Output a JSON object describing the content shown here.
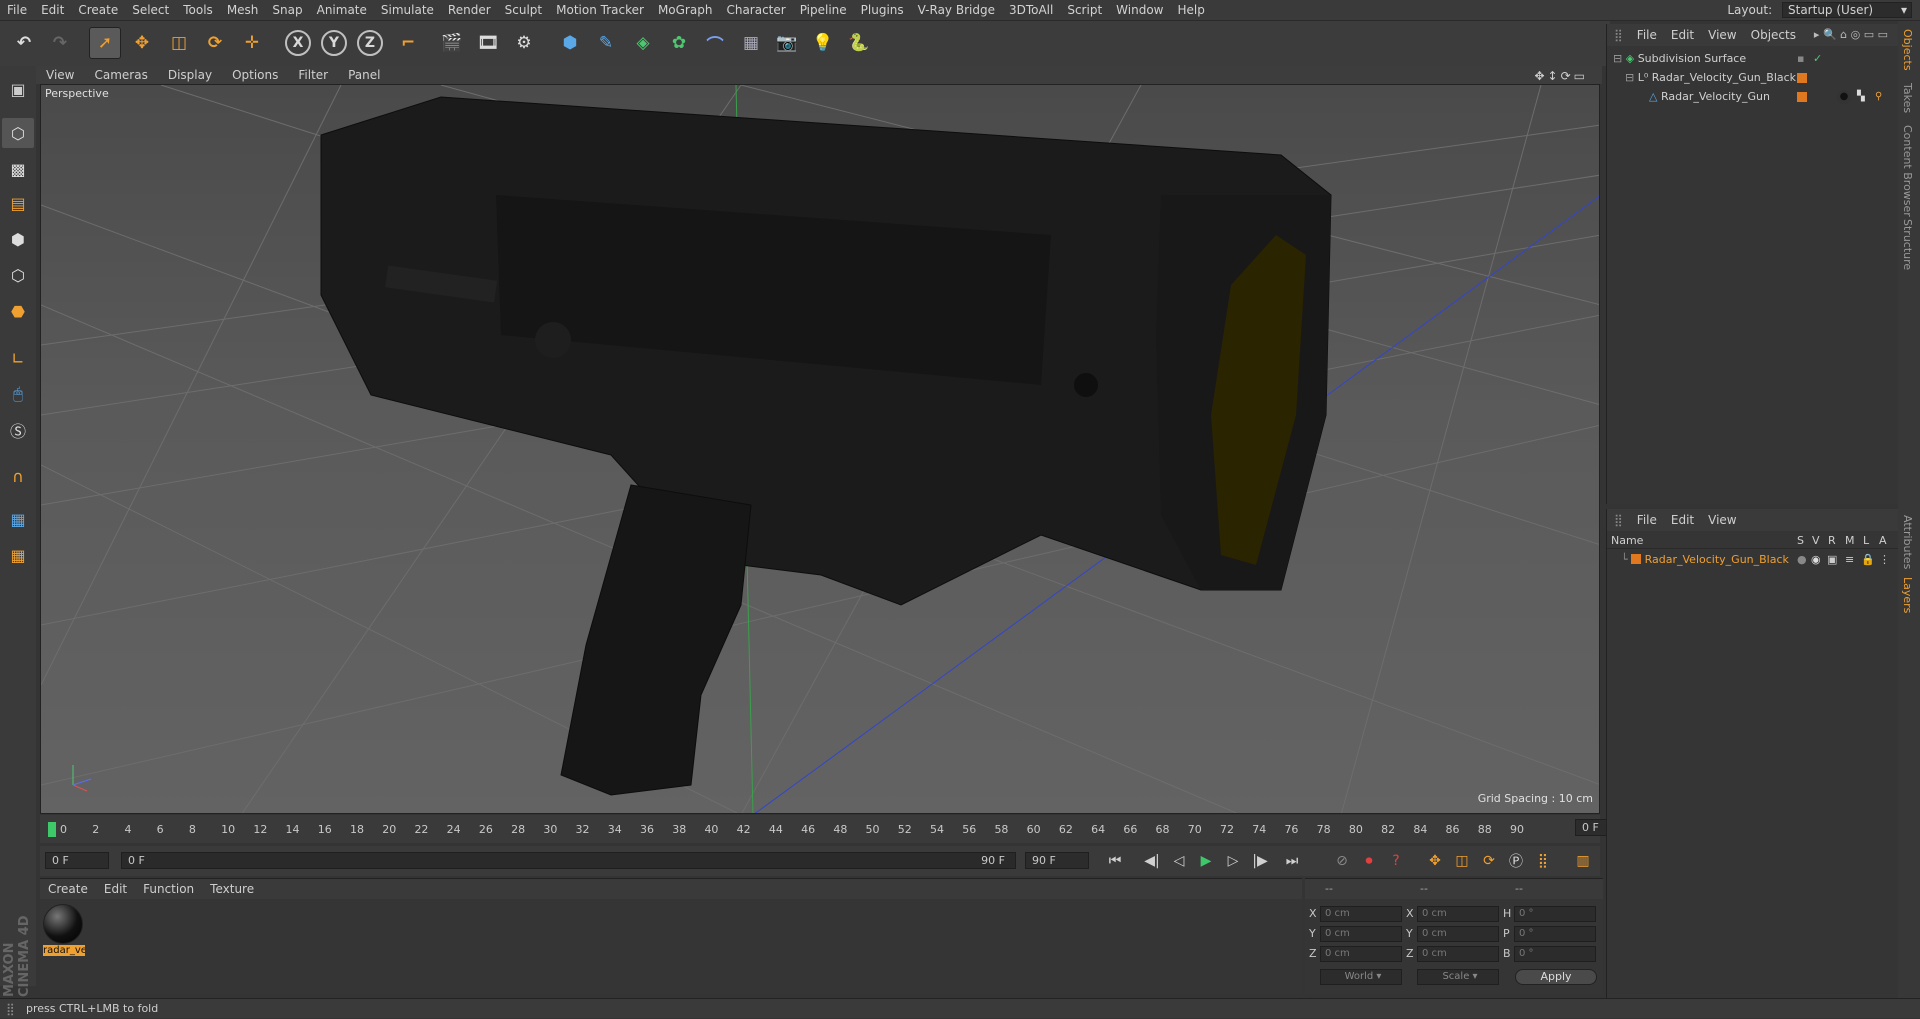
{
  "menubar": {
    "items": [
      "File",
      "Edit",
      "Create",
      "Select",
      "Tools",
      "Mesh",
      "Snap",
      "Animate",
      "Simulate",
      "Render",
      "Sculpt",
      "Motion Tracker",
      "MoGraph",
      "Character",
      "Pipeline",
      "Plugins",
      "V-Ray Bridge",
      "3DToAll",
      "Script",
      "Window",
      "Help"
    ],
    "layout_label": "Layout:",
    "layout_value": "Startup (User)"
  },
  "toolbar": {
    "axis_x": "X",
    "axis_y": "Y",
    "axis_z": "Z"
  },
  "viewport": {
    "menu": [
      "View",
      "Cameras",
      "Display",
      "Options",
      "Filter",
      "Panel"
    ],
    "camera_label": "Perspective",
    "grid_spacing": "Grid Spacing : 10 cm"
  },
  "timeline": {
    "ticks": [
      "0",
      "2",
      "4",
      "6",
      "8",
      "10",
      "12",
      "14",
      "16",
      "18",
      "20",
      "22",
      "24",
      "26",
      "28",
      "30",
      "32",
      "34",
      "36",
      "38",
      "40",
      "42",
      "44",
      "46",
      "48",
      "50",
      "52",
      "54",
      "56",
      "58",
      "60",
      "62",
      "64",
      "66",
      "68",
      "70",
      "72",
      "74",
      "76",
      "78",
      "80",
      "82",
      "84",
      "86",
      "88",
      "90"
    ],
    "current_frame_display": "0 F"
  },
  "playback": {
    "start_field": "0 F",
    "slider_left": "0 F",
    "slider_right": "90 F",
    "end_field": "90 F"
  },
  "material_manager": {
    "menu": [
      "Create",
      "Edit",
      "Function",
      "Texture"
    ],
    "material_name": "radar_ve"
  },
  "coordinates": {
    "header": [
      "--",
      "--",
      "--"
    ],
    "pos_labels": [
      "X",
      "Y",
      "Z"
    ],
    "size_labels": [
      "X",
      "Y",
      "Z"
    ],
    "rot_labels": [
      "H",
      "P",
      "B"
    ],
    "pos_values": [
      "0 cm",
      "0 cm",
      "0 cm"
    ],
    "size_values": [
      "0 cm",
      "0 cm",
      "0 cm"
    ],
    "rot_values": [
      "0 °",
      "0 °",
      "0 °"
    ],
    "mode_world": "World",
    "mode_scale": "Scale",
    "apply": "Apply"
  },
  "object_manager": {
    "menu": [
      "File",
      "Edit",
      "View",
      "Objects"
    ],
    "objects": [
      {
        "name": "Subdivision Surface"
      },
      {
        "name": "Radar_Velocity_Gun_Black"
      },
      {
        "name": "Radar_Velocity_Gun"
      }
    ]
  },
  "layer_manager": {
    "menu": [
      "File",
      "Edit",
      "View"
    ],
    "columns": [
      "Name",
      "S",
      "V",
      "R",
      "M",
      "L",
      "A"
    ],
    "layers": [
      {
        "name": "Radar_Velocity_Gun_Black"
      }
    ]
  },
  "side_tabs": [
    "Objects",
    "Takes",
    "Content Browser",
    "Structure",
    "Attributes",
    "Layers"
  ],
  "status": "press CTRL+LMB to fold",
  "logo_text": "MAXON CINEMA 4D",
  "colors": {
    "accent": "#f0a030",
    "layer_orange": "#e07820",
    "selected_text": "#f0a030"
  }
}
